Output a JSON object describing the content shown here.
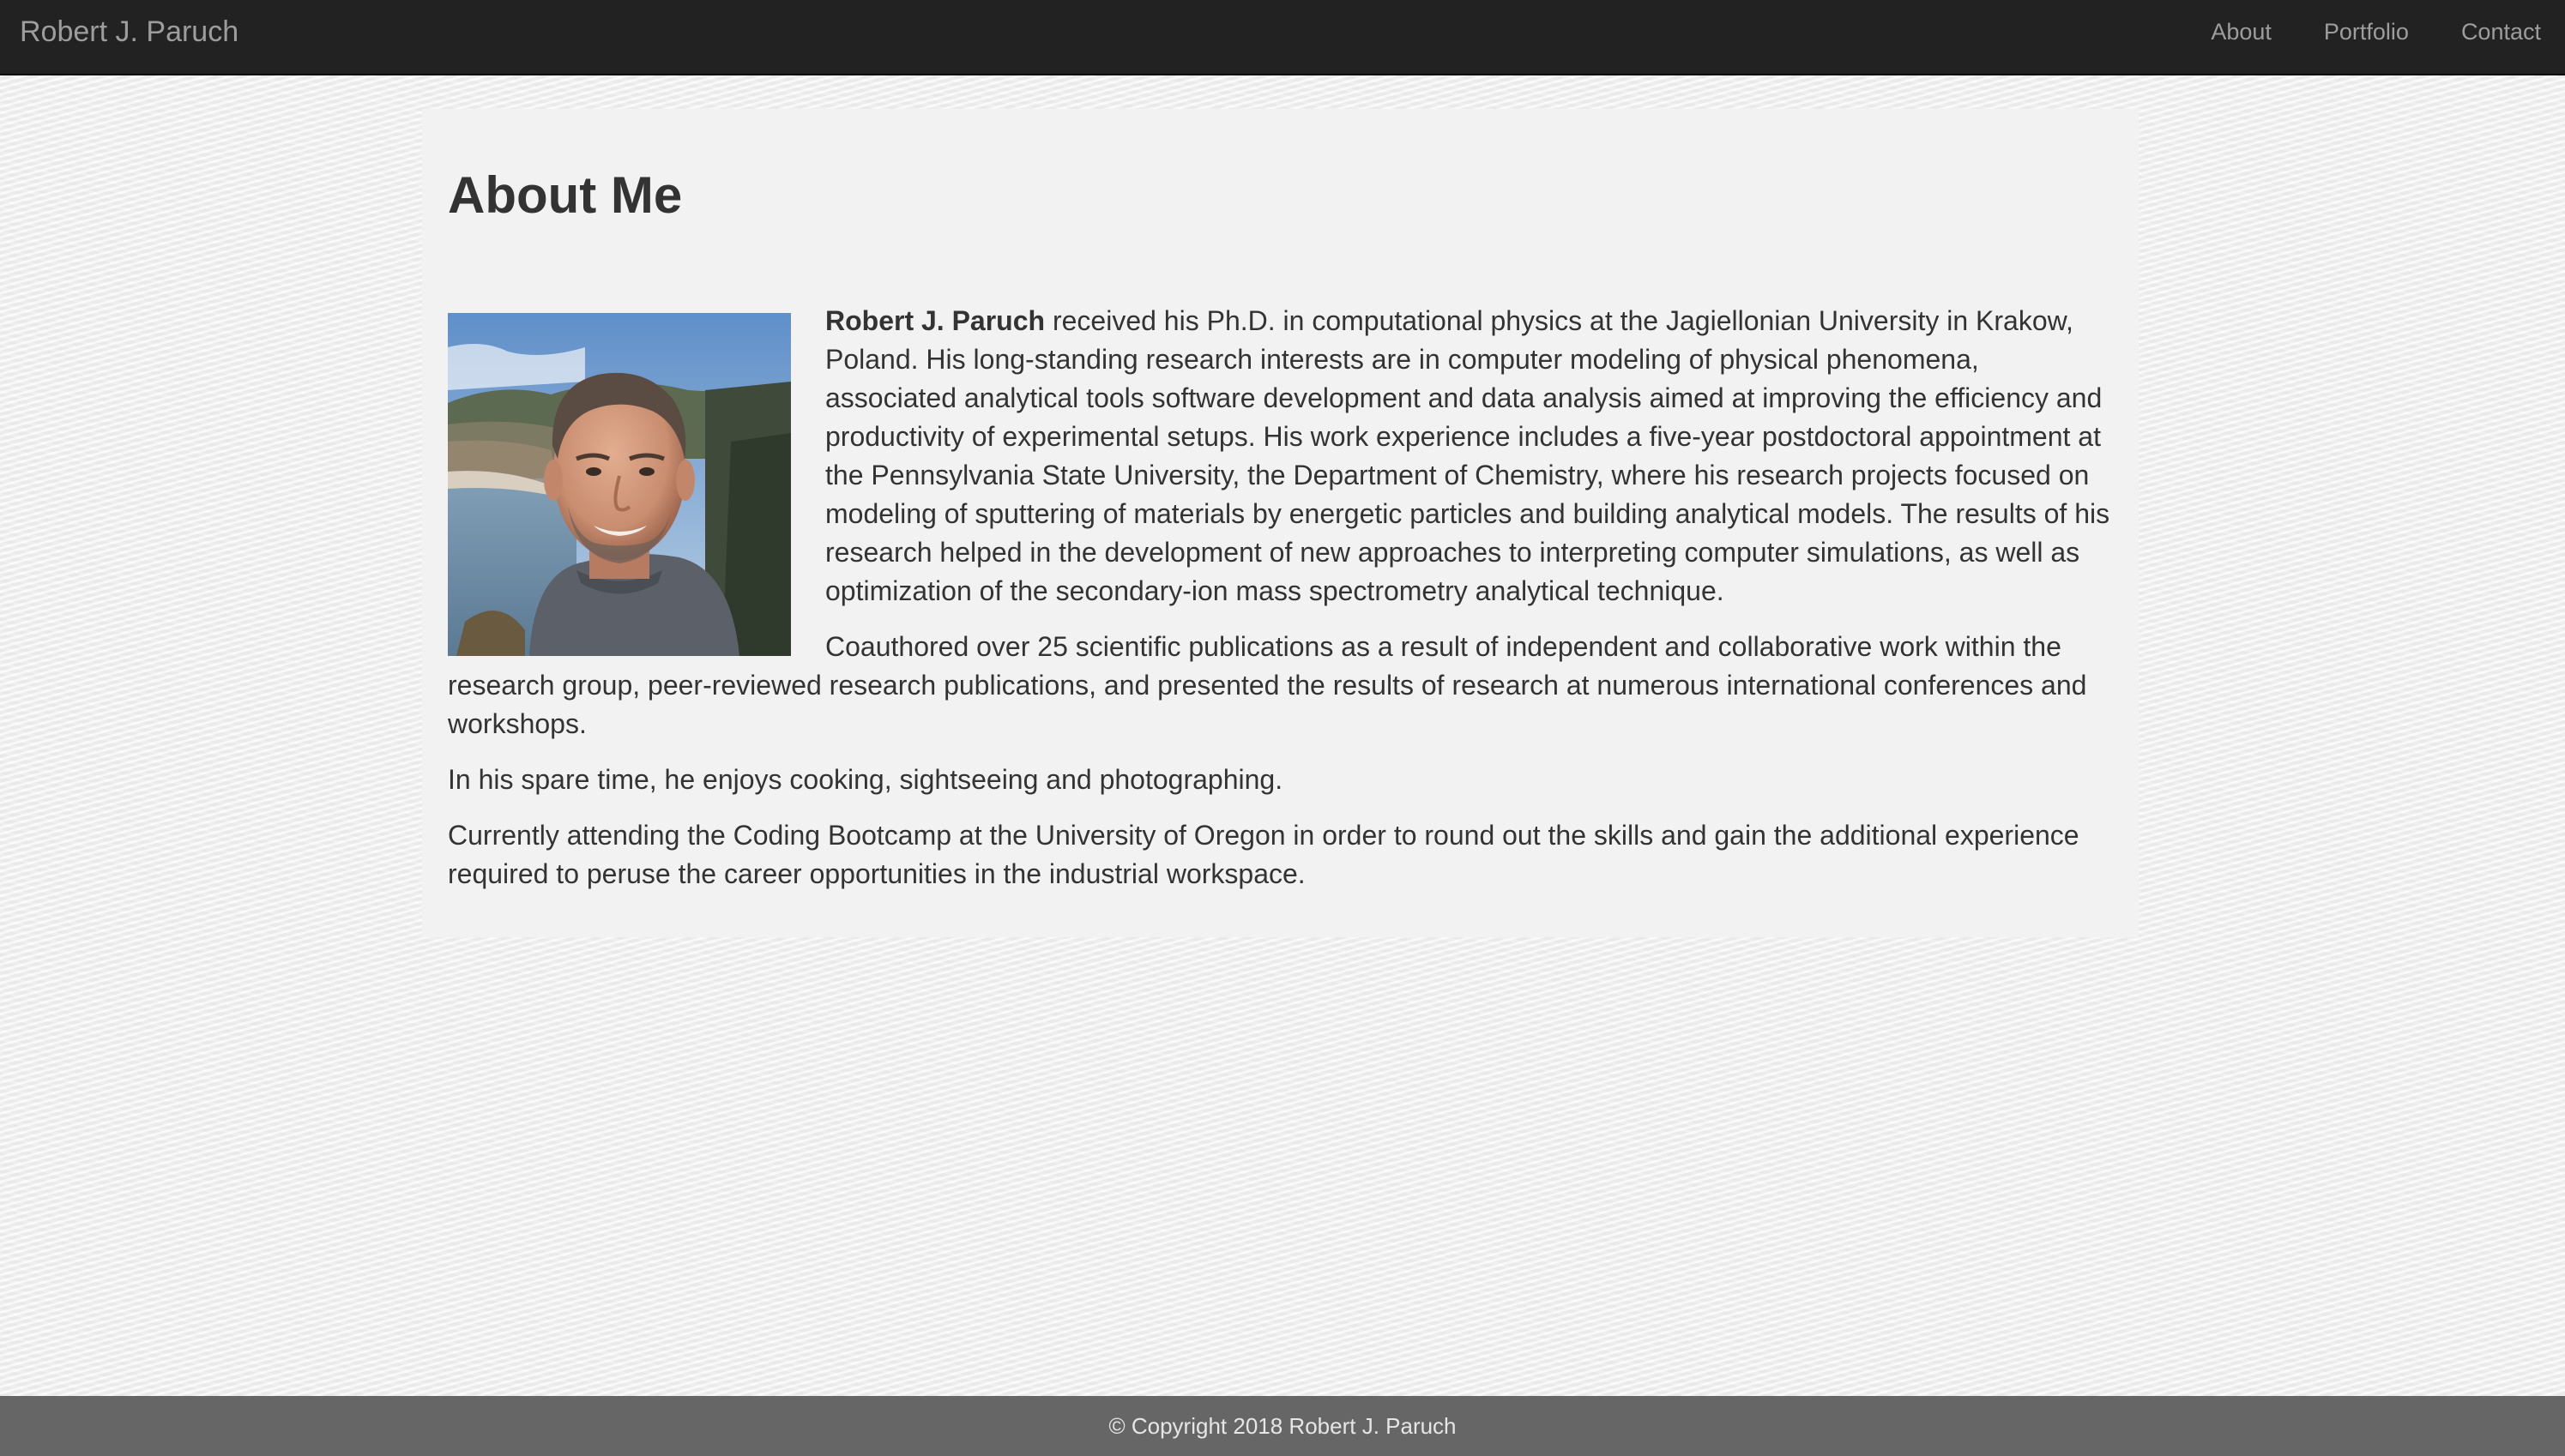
{
  "navbar": {
    "brand": "Robert J. Paruch",
    "links": [
      {
        "label": "About"
      },
      {
        "label": "Portfolio"
      },
      {
        "label": "Contact"
      }
    ]
  },
  "about": {
    "title": "About Me",
    "intro_name": "Robert J. Paruch",
    "intro_rest": " received his Ph.D. in computational physics at the Jagiellonian University in Krakow, Poland. His long-standing research interests are in computer modeling of physical phenomena, associated analytical tools software development and data analysis aimed at improving the efficiency and productivity of experimental setups. His work experience includes a five-year postdoctoral appointment at the Pennsylvania State University, the Department of Chemistry, where his research projects focused on modeling of sputtering of materials by energetic particles and building analytical models. The results of his research helped in the development of new approaches to interpreting computer simulations, as well as optimization of the secondary-ion mass spectrometry analytical technique.",
    "paragraph2": "Coauthored over 25 scientific publications as a result of independent and collaborative work within the research group, peer-reviewed research publications, and presented the results of research at numerous international conferences and workshops.",
    "paragraph3": "In his spare time, he enjoys cooking, sightseeing and photographing.",
    "paragraph4": "Currently attending the Coding Bootcamp at the University of Oregon in order to round out the skills and gain the additional experience required to peruse the career opportunities in the industrial workspace."
  },
  "footer": {
    "text": "© Copyright 2018 Robert J. Paruch"
  },
  "colors": {
    "navbar_bg": "#222222",
    "nav_text": "#9d9d9d",
    "card_bg": "#f2f2f2",
    "footer_bg": "#666666",
    "text": "#333333"
  }
}
